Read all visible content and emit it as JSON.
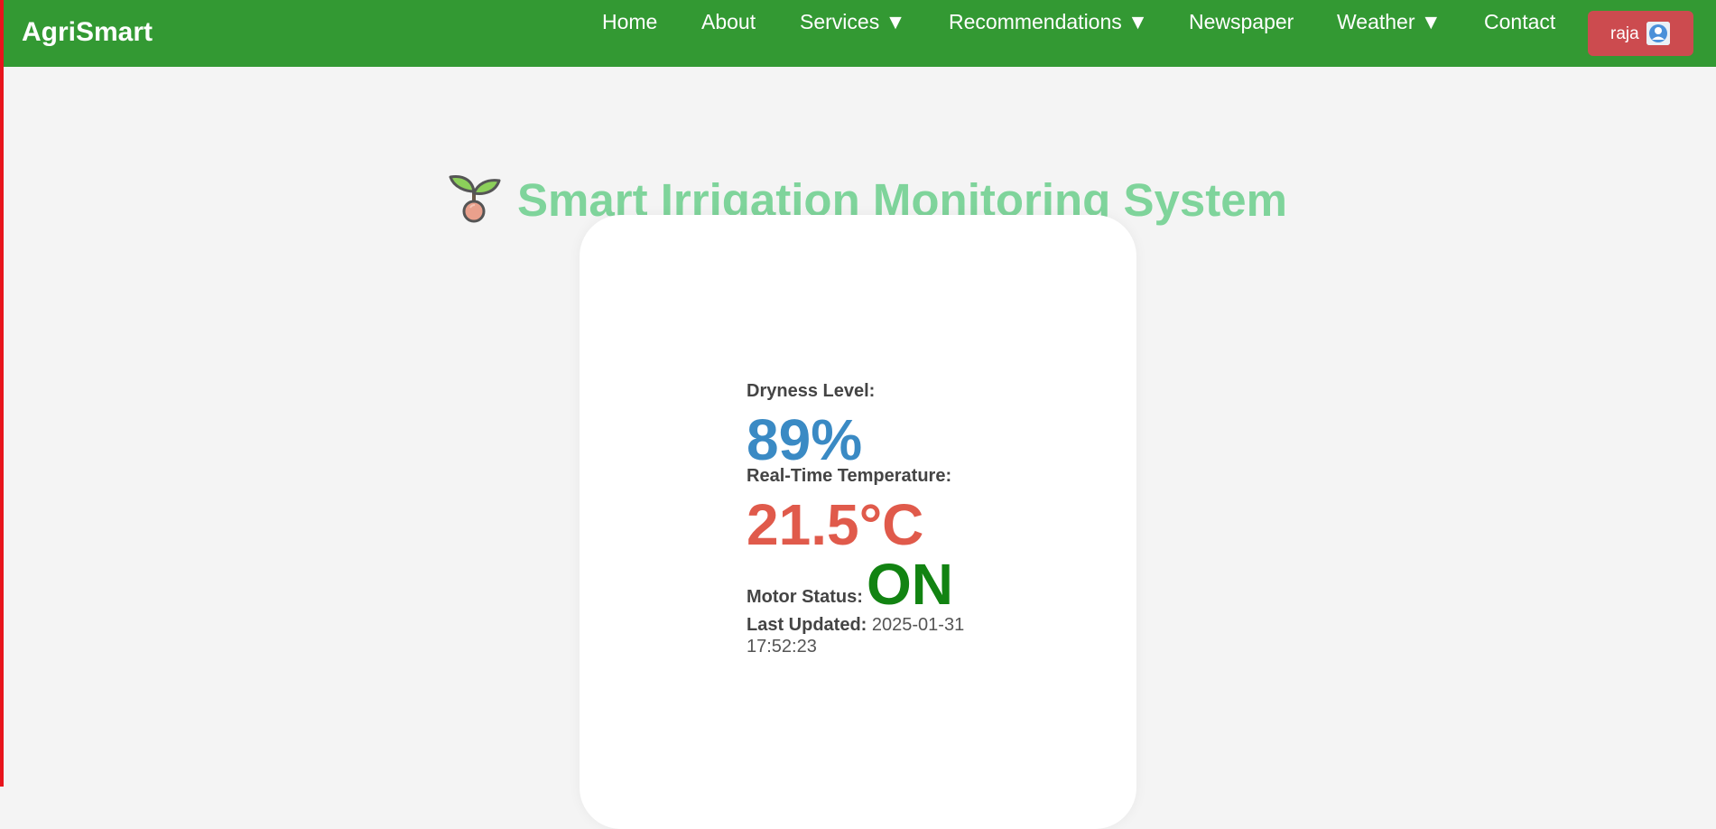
{
  "nav": {
    "brand": "AgriSmart",
    "items": [
      {
        "label": "Home"
      },
      {
        "label": "About"
      },
      {
        "label": "Services ▼"
      },
      {
        "label": "Recommendations ▼"
      },
      {
        "label": "Newspaper"
      },
      {
        "label": "Weather ▼"
      },
      {
        "label": "Contact"
      }
    ],
    "user": {
      "name": "raja",
      "icon": "user-avatar-icon"
    }
  },
  "page": {
    "title": "Smart Irrigation Monitoring System",
    "title_icon": "sprout-icon"
  },
  "monitor": {
    "dryness_label": "Dryness Level:",
    "dryness_value": "89%",
    "temperature_label": "Real-Time Temperature:",
    "temperature_value": "21.5°C",
    "motor_label": "Motor Status:",
    "motor_value": "ON",
    "updated_label": "Last Updated:",
    "updated_value": "2025-01-31 17:52:23"
  },
  "colors": {
    "navbar": "#339933",
    "user_button": "#cc4b4f",
    "title": "#7fd49b",
    "dryness": "#3a8ac4",
    "temperature": "#e05a4b",
    "motor_on": "#128312"
  }
}
